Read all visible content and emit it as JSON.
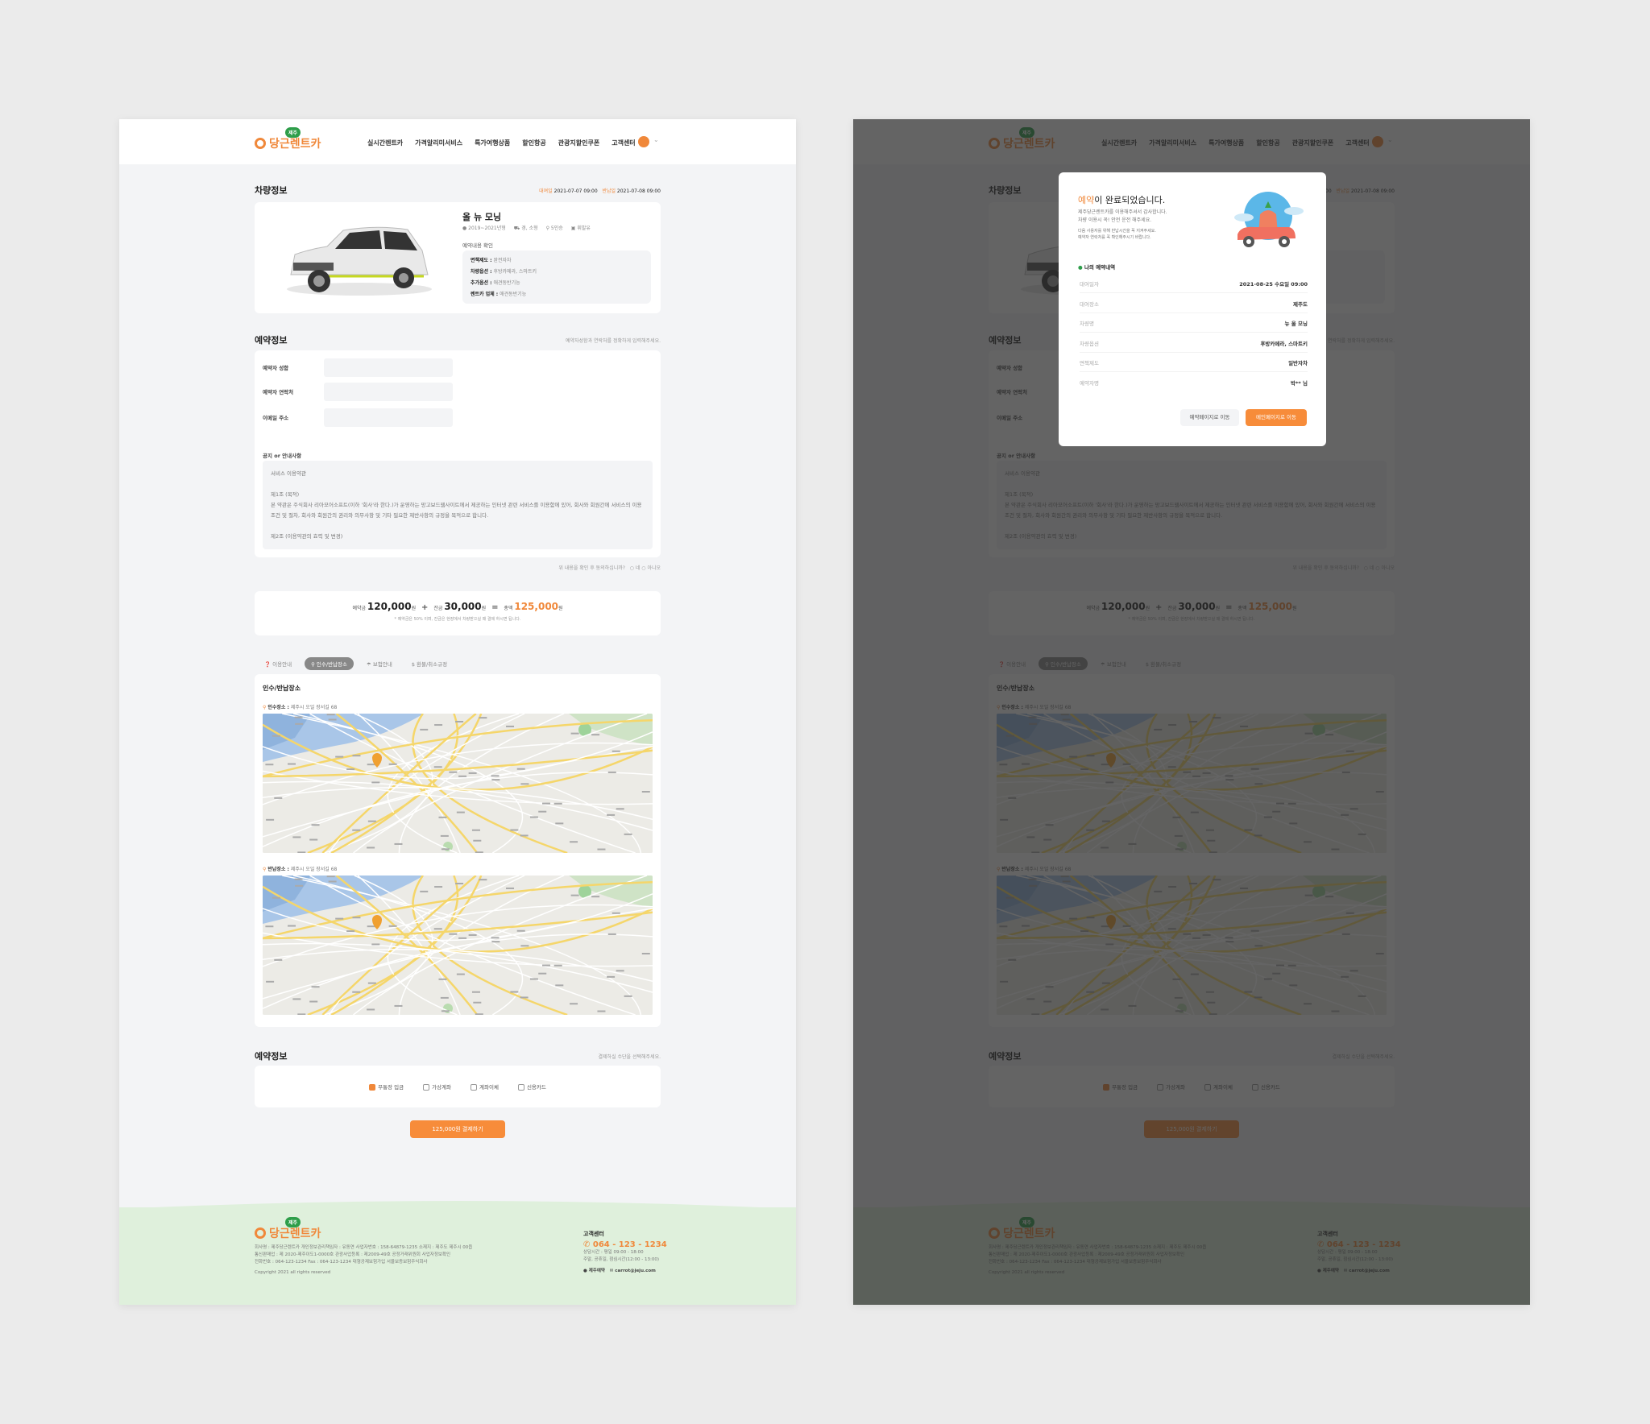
{
  "header": {
    "logo_text": "당근렌트카",
    "logo_badge": "제주",
    "nav": [
      "실시간렌트카",
      "가격알리미서비스",
      "특가여행상품",
      "할인항공",
      "관광지할인쿠폰",
      "고객센터"
    ]
  },
  "vehicle": {
    "title": "차량정보",
    "rent_label": "대여일",
    "rent_date": "2021-07-07 09:00",
    "return_label": "반납일",
    "return_date": "2021-07-08 09:00",
    "name": "올 뉴 모닝",
    "specs": [
      "2019~2021년형",
      "경, 소형",
      "5인승",
      "휘발유"
    ],
    "confirm_title": "예약내용 확인",
    "details": [
      {
        "k": "면책제도 :",
        "v": "완전자차"
      },
      {
        "k": "차량옵션 :",
        "v": "후방카메라, 스마트키"
      },
      {
        "k": "추가옵션 :",
        "v": "애견동반기능"
      },
      {
        "k": "렌트카 업체 :",
        "v": "애견동반기능"
      }
    ]
  },
  "reservation": {
    "title": "예약정보",
    "hint": "예약자성함과 연락처를 정확하게 입력해주세요.",
    "fields": [
      {
        "label": "예약자 성함",
        "value": ""
      },
      {
        "label": "예약자 연락처",
        "value": ""
      },
      {
        "label": "이메일 주소",
        "value": ""
      }
    ],
    "notice_title": "공지 or 안내사항",
    "terms": [
      "서비스 이용약관",
      "제1조 (목적)",
      "본 약관은 주식회사 리아모어소프트(이하 '회사'라 한다.)가 운영하는 망고보드웹사이트에서 제공하는 인터넷 관련 서비스를 이용함에 있어, 회사와 회원간에 서비스의 이용조건 및 절차, 회사와 회원간의 권리와 의무사항 및 기타 필요한 제반사항의 규정을 목적으로 합니다.",
      "제2조 (이용약관의 효력 및 변경)"
    ],
    "agree_q": "위 내용을 확인 후 동의하십니까?",
    "agree_yes": "네",
    "agree_no": "아니오"
  },
  "price": {
    "deposit_label": "예약금",
    "deposit": "120,000",
    "balance_label": "잔금",
    "balance": "30,000",
    "total_label": "총액",
    "total": "125,000",
    "unit": "원",
    "plus": "+",
    "eq": "=",
    "note": "* 예약금은 50% 이며, 잔금은 현장에서 차량받으실 때 결제 하시면 됩니다."
  },
  "tabs": [
    {
      "label": "이용안내",
      "icon": "question-icon"
    },
    {
      "label": "인수/반납장소",
      "icon": "pin-icon",
      "active": true
    },
    {
      "label": "보험안내",
      "icon": "insurance-icon"
    },
    {
      "label": "환불/취소규정",
      "icon": "dollar-icon"
    }
  ],
  "location": {
    "title": "인수/반납장소",
    "pickup_label": "인수장소 :",
    "pickup": "제주시 오일 장서길 68",
    "return_label": "반납장소 :",
    "return": "제주시 오일 장서길 68"
  },
  "payment": {
    "title": "예약정보",
    "hint": "결제하실 수단을 선택해주세요.",
    "methods": [
      {
        "label": "무통장 입금",
        "checked": true
      },
      {
        "label": "가상계좌",
        "checked": false
      },
      {
        "label": "계좌이체",
        "checked": false
      },
      {
        "label": "신용카드",
        "checked": false
      }
    ],
    "button": "125,000원 결제하기"
  },
  "footer": {
    "lines": [
      "회사명 : 제주당근렌트카    개인정보관리책임자 : 유동연    사업자번호 : 158-64879-1235    소재지 : 제주도 제주시 00읍",
      "통신판매업 : 제 2020-제주이도1-0000호    관광사업등록 : 제2009-49호    공정거래위원회 사업자정보확인",
      "전화번호 : 064-123-1234    Fax : 064-123-1234    대형공제보험가입 서울보증보험주식회사"
    ],
    "copyright": "Copyright 2021 all rights reserved",
    "cs_title": "고객센터",
    "phone": "064 - 123 - 1234",
    "hours1": "상담시간 : 평일 09:00 - 18:00",
    "hours2": "주말, 공휴일, 점심시간(12:00 - 13:00)",
    "kakao": "제주예약",
    "email": "carrot@jeju.com"
  },
  "modal": {
    "title_accent": "예약",
    "title_rest": "이 완료되었습니다.",
    "sub1": "제주당근렌트카를 이용해주셔서 감사합니다.",
    "sub2": "차량 이용시 꼭! 안전 운전 해주세요.",
    "note1": "다음 사용자를 위해 반납시간을 꼭 지켜주세요.",
    "note2": "예약자 연락처를 꼭 확인해주시기 바랍니다.",
    "section": "나의 예약내역",
    "rows": [
      {
        "k": "대여일자",
        "v": "2021-08-25 수요일 09:00"
      },
      {
        "k": "대여장소",
        "v": "제주도"
      },
      {
        "k": "차량명",
        "v": "뉴 올 모닝"
      },
      {
        "k": "차량옵션",
        "v": "후방카메라, 스마트키"
      },
      {
        "k": "면책제도",
        "v": "일반자차"
      },
      {
        "k": "예약자명",
        "v": "박** 님"
      }
    ],
    "btn_secondary": "예약페이지로 이동",
    "btn_primary": "메인페이지로 이동"
  },
  "colors": {
    "accent": "#f78c3a",
    "footer_bg": "#dff0dc",
    "page_bg": "#f3f4f6"
  }
}
